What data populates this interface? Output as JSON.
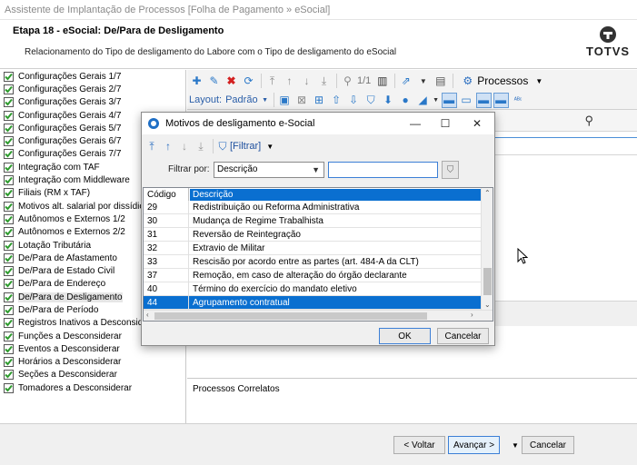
{
  "window": {
    "title": "Assistente de Implantação de Processos [Folha de Pagamento » eSocial]"
  },
  "header": {
    "step_title": "Etapa 18 - eSocial: De/Para de Desligamento",
    "subtitle": "Relacionamento do Tipo de desligamento do Labore com o Tipo de desligamento do eSocial",
    "logo_text": "TOTVS"
  },
  "sidebar": {
    "items": [
      {
        "label": "Configurações Gerais 1/7"
      },
      {
        "label": "Configurações Gerais 2/7"
      },
      {
        "label": "Configurações Gerais 3/7"
      },
      {
        "label": "Configurações Gerais 4/7"
      },
      {
        "label": "Configurações Gerais 5/7"
      },
      {
        "label": "Configurações Gerais 6/7"
      },
      {
        "label": "Configurações Gerais 7/7"
      },
      {
        "label": "Integração com TAF"
      },
      {
        "label": "Integração com Middleware"
      },
      {
        "label": "Filiais (RM x TAF)"
      },
      {
        "label": "Motivos alt. salarial por dissídio"
      },
      {
        "label": "Autônomos e Externos 1/2"
      },
      {
        "label": "Autônomos e Externos 2/2"
      },
      {
        "label": "Lotação Tributária"
      },
      {
        "label": "De/Para de Afastamento"
      },
      {
        "label": "De/Para de Estado Civil"
      },
      {
        "label": "De/Para de Endereço"
      },
      {
        "label": "De/Para de Desligamento",
        "selected": true
      },
      {
        "label": "De/Para de Período"
      },
      {
        "label": "Registros Inativos a Desconsiderar"
      },
      {
        "label": "Funções a Desconsiderar"
      },
      {
        "label": "Eventos a Desconsiderar"
      },
      {
        "label": "Horários a Desconsiderar"
      },
      {
        "label": "Seções a Desconsiderar"
      },
      {
        "label": "Tomadores a Desconsiderar"
      }
    ]
  },
  "toolbar": {
    "record_counter": "1/1",
    "processes_label": "Processos",
    "layout_label": "Layout:",
    "layout_value": "Padrão"
  },
  "correlated": {
    "label": "Processos Correlatos"
  },
  "footer": {
    "back_label": "< Voltar",
    "next_label": "Avançar >",
    "cancel_label": "Cancelar"
  },
  "dialog": {
    "title": "Motivos de desligamento e-Social",
    "filter_button_label": "[Filtrar]",
    "filter_by_label": "Filtrar por:",
    "filter_field_value": "Descrição",
    "search_value": "",
    "columns": {
      "code": "Código",
      "description": "Descrição"
    },
    "rows": [
      {
        "code": "29",
        "description": "Redistribuição ou Reforma Administrativa"
      },
      {
        "code": "30",
        "description": "Mudança de Regime Trabalhista"
      },
      {
        "code": "31",
        "description": "Reversão de Reintegração"
      },
      {
        "code": "32",
        "description": "Extravio de Militar"
      },
      {
        "code": "33",
        "description": "Rescisão por acordo entre as partes (art. 484-A da CLT)"
      },
      {
        "code": "37",
        "description": "Remoção, em caso de alteração do órgão declarante"
      },
      {
        "code": "40",
        "description": "Término do exercício do mandato eletivo"
      },
      {
        "code": "44",
        "description": "Agrupamento contratual",
        "selected": true
      }
    ],
    "ok_label": "OK",
    "cancel_label": "Cancelar"
  },
  "colors": {
    "accent_blue": "#0a6fd0",
    "check_green": "#2e9b2e",
    "delete_red": "#d32020"
  }
}
